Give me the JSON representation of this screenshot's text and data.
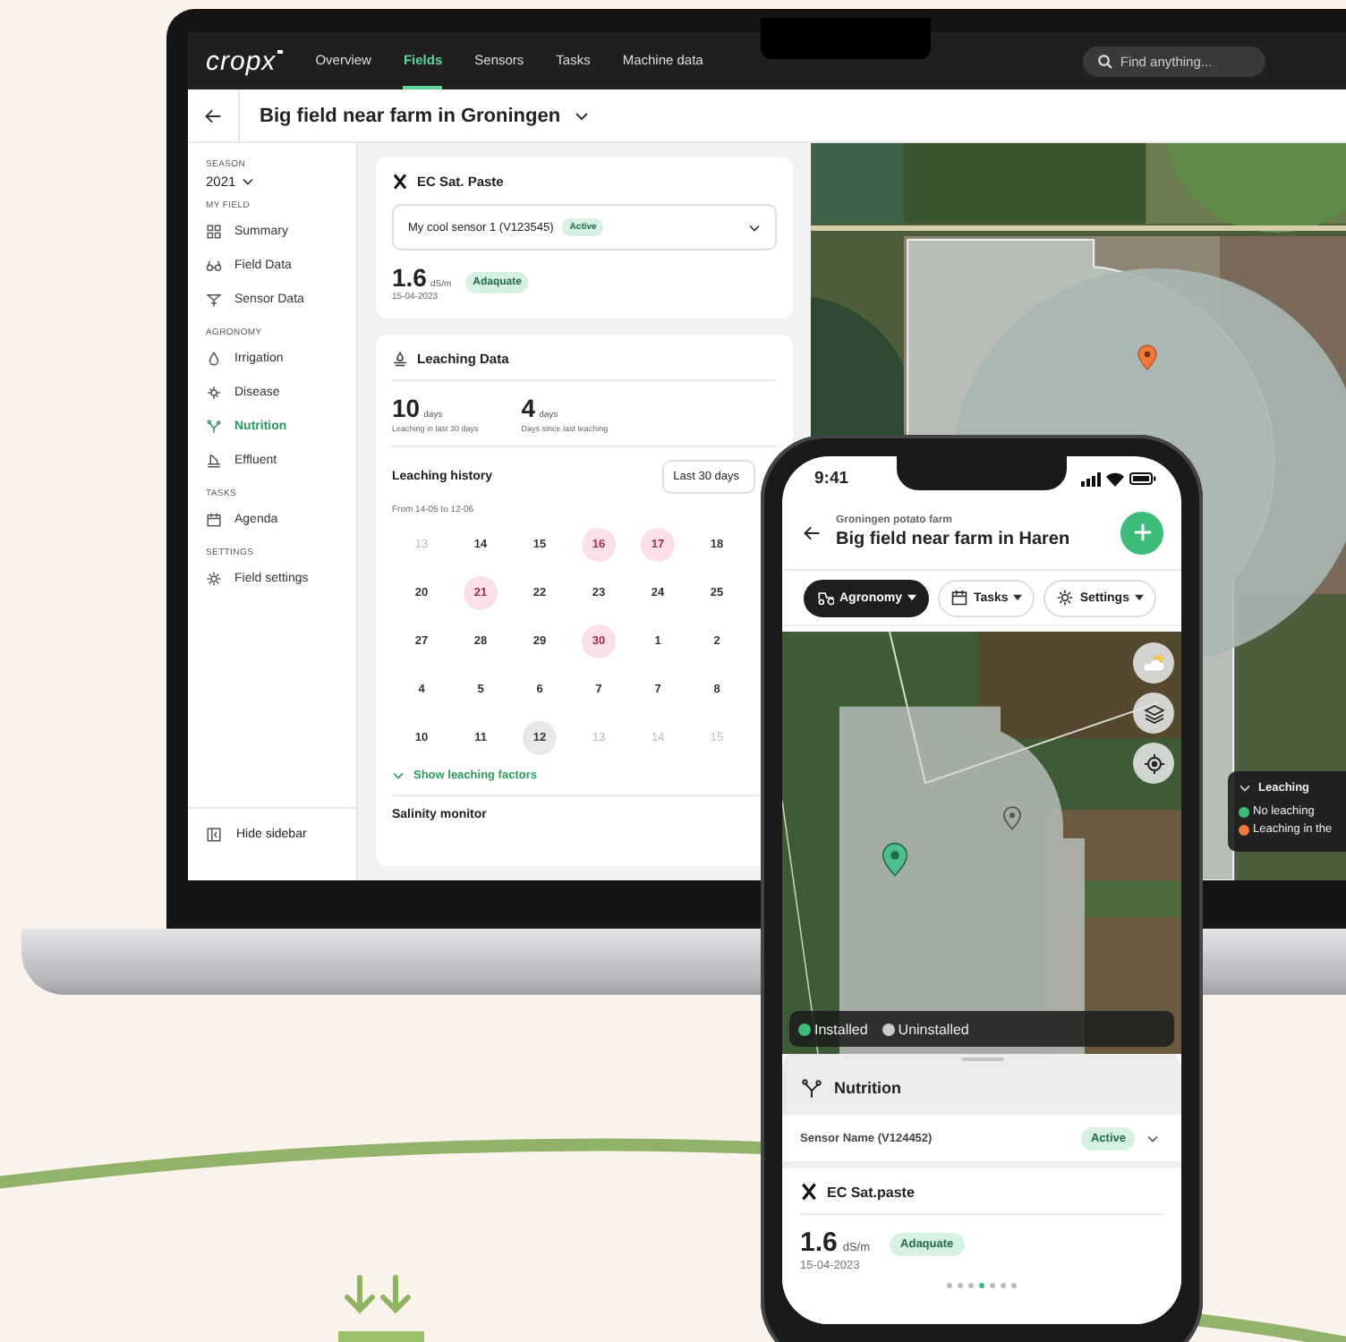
{
  "laptop": {
    "nav": {
      "logo": "cropx",
      "tabs": [
        {
          "label": "Overview",
          "selected": false
        },
        {
          "label": "Fields",
          "selected": true
        },
        {
          "label": "Sensors",
          "selected": false
        },
        {
          "label": "Tasks",
          "selected": false
        },
        {
          "label": "Machine data",
          "selected": false
        }
      ],
      "search": {
        "placeholder": "Find anything..."
      }
    },
    "header": {
      "title": "Big field near farm in Groningen"
    },
    "sidebar": {
      "season_label": "SEASON",
      "season": "2021",
      "sections": [
        {
          "heading": "MY FIELD",
          "items": [
            {
              "label": "Summary",
              "selected": false
            },
            {
              "label": "Field Data",
              "selected": false
            },
            {
              "label": "Sensor Data",
              "selected": false
            }
          ]
        },
        {
          "heading": "AGRONOMY",
          "items": [
            {
              "label": "Irrigation",
              "selected": false
            },
            {
              "label": "Disease",
              "selected": false
            },
            {
              "label": "Nutrition",
              "selected": true
            },
            {
              "label": "Effluent",
              "selected": false
            }
          ]
        },
        {
          "heading": "TASKS",
          "items": [
            {
              "label": "Agenda",
              "selected": false
            }
          ]
        },
        {
          "heading": "SETTINGS",
          "items": [
            {
              "label": "Field settings",
              "selected": false
            }
          ]
        }
      ],
      "hide_label": "Hide sidebar"
    },
    "sensor_card": {
      "title": "EC Sat. Paste",
      "sensor": "My cool sensor 1 (V123545)",
      "status": "Active",
      "value": "1.6",
      "unit": "dS/m",
      "date": "15-04-2023",
      "rating": "Adaquate"
    },
    "leaching_card": {
      "title": "Leaching Data",
      "stats": [
        {
          "value": "10",
          "unit": "days",
          "caption": "Leaching in last 30 days"
        },
        {
          "value": "4",
          "unit": "days",
          "caption": "Days since last leaching"
        }
      ],
      "history_title": "Leaching history",
      "range": "Last 30 days",
      "period": "From 14-05 to 12-06",
      "calendar": [
        [
          {
            "label": "13",
            "muted": true,
            "leaching": false,
            "today": false
          },
          {
            "label": "14",
            "muted": false,
            "leaching": false,
            "today": false
          },
          {
            "label": "15",
            "muted": false,
            "leaching": false,
            "today": false
          },
          {
            "label": "16",
            "muted": false,
            "leaching": true,
            "today": false
          },
          {
            "label": "17",
            "muted": false,
            "leaching": true,
            "today": false
          },
          {
            "label": "18",
            "muted": false,
            "leaching": false,
            "today": false
          }
        ],
        [
          {
            "label": "20",
            "muted": false,
            "leaching": false,
            "today": false
          },
          {
            "label": "21",
            "muted": false,
            "leaching": true,
            "today": false
          },
          {
            "label": "22",
            "muted": false,
            "leaching": false,
            "today": false
          },
          {
            "label": "23",
            "muted": false,
            "leaching": false,
            "today": false
          },
          {
            "label": "24",
            "muted": false,
            "leaching": false,
            "today": false
          },
          {
            "label": "25",
            "muted": false,
            "leaching": false,
            "today": false
          }
        ],
        [
          {
            "label": "27",
            "muted": false,
            "leaching": false,
            "today": false
          },
          {
            "label": "28",
            "muted": false,
            "leaching": false,
            "today": false
          },
          {
            "label": "29",
            "muted": false,
            "leaching": false,
            "today": false
          },
          {
            "label": "30",
            "muted": false,
            "leaching": true,
            "today": false
          },
          {
            "label": "1",
            "muted": false,
            "leaching": false,
            "today": false
          },
          {
            "label": "2",
            "muted": false,
            "leaching": false,
            "today": false
          }
        ],
        [
          {
            "label": "4",
            "muted": false,
            "leaching": false,
            "today": false
          },
          {
            "label": "5",
            "muted": false,
            "leaching": false,
            "today": false
          },
          {
            "label": "6",
            "muted": false,
            "leaching": false,
            "today": false
          },
          {
            "label": "7",
            "muted": false,
            "leaching": false,
            "today": false
          },
          {
            "label": "7",
            "muted": false,
            "leaching": false,
            "today": false
          },
          {
            "label": "8",
            "muted": false,
            "leaching": false,
            "today": false
          }
        ],
        [
          {
            "label": "10",
            "muted": false,
            "leaching": false,
            "today": false
          },
          {
            "label": "11",
            "muted": false,
            "leaching": false,
            "today": false
          },
          {
            "label": "12",
            "muted": false,
            "leaching": false,
            "today": true
          },
          {
            "label": "13",
            "muted": true,
            "leaching": false,
            "today": false
          },
          {
            "label": "14",
            "muted": true,
            "leaching": false,
            "today": false
          },
          {
            "label": "15",
            "muted": true,
            "leaching": false,
            "today": false
          }
        ]
      ],
      "link": "Show leaching factors",
      "next_section": "Salinity monitor"
    },
    "map_legend": {
      "title": "Leaching",
      "items": [
        {
          "label": "No leaching",
          "color": "#3dbb7a"
        },
        {
          "label": "Leaching in the",
          "color": "#f07a3c"
        }
      ]
    }
  },
  "phone": {
    "time": "9:41",
    "subtitle": "Groningen potato farm",
    "title": "Big field near farm in Haren",
    "chips": [
      {
        "label": "Agronomy",
        "selected": true
      },
      {
        "label": "Tasks",
        "selected": false
      },
      {
        "label": "Settings",
        "selected": false
      }
    ],
    "legend": [
      {
        "label": "Installed",
        "color": "#3dbb7a"
      },
      {
        "label": "Uninstalled",
        "color": "#c8c8c8"
      }
    ],
    "sheet": {
      "title": "Nutrition",
      "sensor": "Sensor Name (V124452)",
      "status": "Active",
      "metric": "EC Sat.paste",
      "value": "1.6",
      "unit": "dS/m",
      "rating": "Adaquate",
      "date": "15-04-2023",
      "page_dots": [
        {
          "selected": false
        },
        {
          "selected": false
        },
        {
          "selected": false
        },
        {
          "selected": true
        },
        {
          "selected": false
        },
        {
          "selected": false
        },
        {
          "selected": false
        }
      ]
    }
  }
}
